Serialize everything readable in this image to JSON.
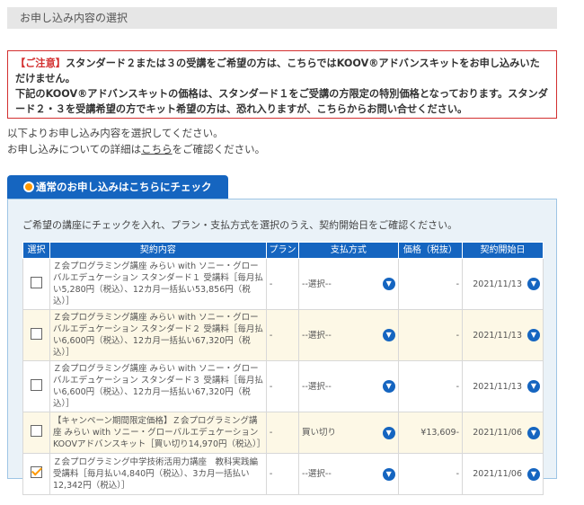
{
  "section_title": "お申し込み内容の選択",
  "notice": {
    "tag": "【ご注意】",
    "text1": "スタンダード２または３の受講をご希望の方は、",
    "link1": "こちら",
    "text2": "ではKOOV®アドバンスキットをお申し込みいただけません。",
    "text3": "下記のKOOV®アドバンスキットの価格は、スタンダード１をご受講の方限定の特別価格となっております。スタンダード２・３を受講希望の方でキット希望の方は、恐れ入りますが、",
    "link2": "こちら",
    "text4": "からお問い合せください。"
  },
  "intro": {
    "line1": "以下よりお申し込み内容を選択してください。",
    "line2_pre": "お申し込みについての詳細は",
    "line2_link": "こちら",
    "line2_post": "をご確認ください。"
  },
  "tab_label": "通常のお申し込みはこちらにチェック",
  "instruction": "ご希望の講座にチェックを入れ、プラン・支払方式を選択のうえ、契約開始日をご確認ください。",
  "table": {
    "headers": {
      "select": "選択",
      "contract": "契約内容",
      "plan": "プラン",
      "payment": "支払方式",
      "price": "価格（税抜）",
      "start": "契約開始日"
    },
    "rows": [
      {
        "checked": false,
        "desc": "Ｚ会プログラミング講座 みらい with ソニー・グローバルエデュケーション スタンダード１ 受講料［毎月払い5,280円（税込）、12カ月一括払い53,856円（税込）］",
        "plan": "-",
        "payment": "--選択--",
        "price": "-",
        "start": "2021/11/13"
      },
      {
        "checked": false,
        "desc": "Ｚ会プログラミング講座 みらい with ソニー・グローバルエデュケーション スタンダード２ 受講料［毎月払い6,600円（税込）、12カ月一括払い67,320円（税込）］",
        "plan": "-",
        "payment": "--選択--",
        "price": "-",
        "start": "2021/11/13"
      },
      {
        "checked": false,
        "desc": "Ｚ会プログラミング講座 みらい with ソニー・グローバルエデュケーション スタンダード３ 受講料［毎月払い6,600円（税込）、12カ月一括払い67,320円（税込）］",
        "plan": "-",
        "payment": "--選択--",
        "price": "-",
        "start": "2021/11/13"
      },
      {
        "checked": false,
        "desc": "【キャンペーン期間限定価格】Ｚ会プログラミング講座 みらい with ソニー・グローバルエデュケーション KOOVアドバンスキット［買い切り14,970円（税込）］",
        "plan": "-",
        "payment": "買い切り",
        "price": "¥13,609-",
        "start": "2021/11/06"
      },
      {
        "checked": true,
        "desc": "Ｚ会プログラミング中学技術活用力講座　教科実践編　受講料［毎月払い4,840円（税込）、3カ月一括払い12,342円（税込）］",
        "plan": "-",
        "payment": "--選択--",
        "price": "-",
        "start": "2021/11/06"
      }
    ]
  }
}
